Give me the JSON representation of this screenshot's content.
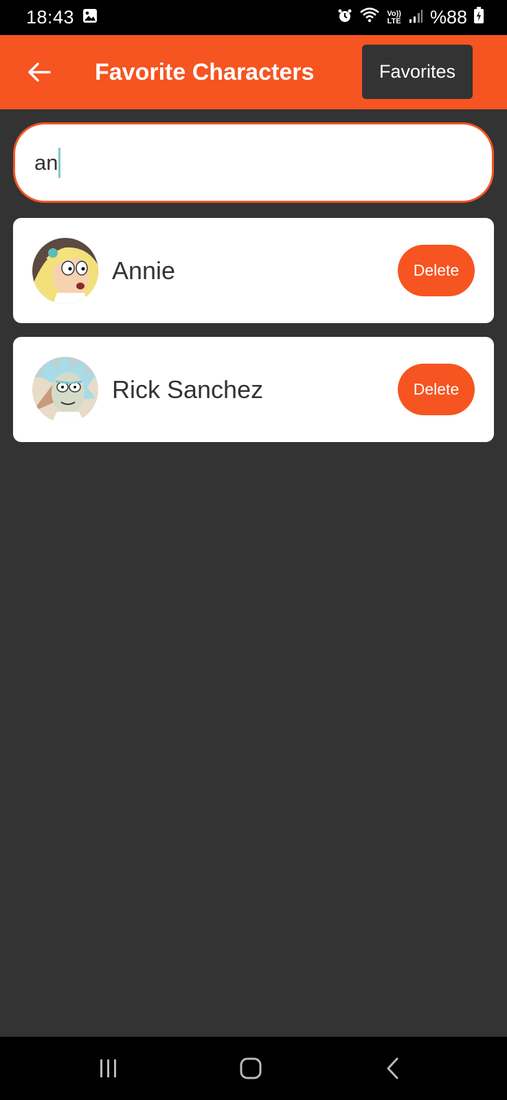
{
  "status_bar": {
    "time": "18:43",
    "battery": "%88",
    "network_top": "Vo))",
    "network_bottom": "LTE"
  },
  "app_bar": {
    "title": "Favorite Characters",
    "favorites_label": "Favorites"
  },
  "search": {
    "value": "an"
  },
  "characters": [
    {
      "name": "Annie",
      "delete_label": "Delete"
    },
    {
      "name": "Rick Sanchez",
      "delete_label": "Delete"
    }
  ],
  "colors": {
    "accent": "#f65421",
    "background": "#333333",
    "card": "#ffffff",
    "caret": "#7fcbc4"
  }
}
